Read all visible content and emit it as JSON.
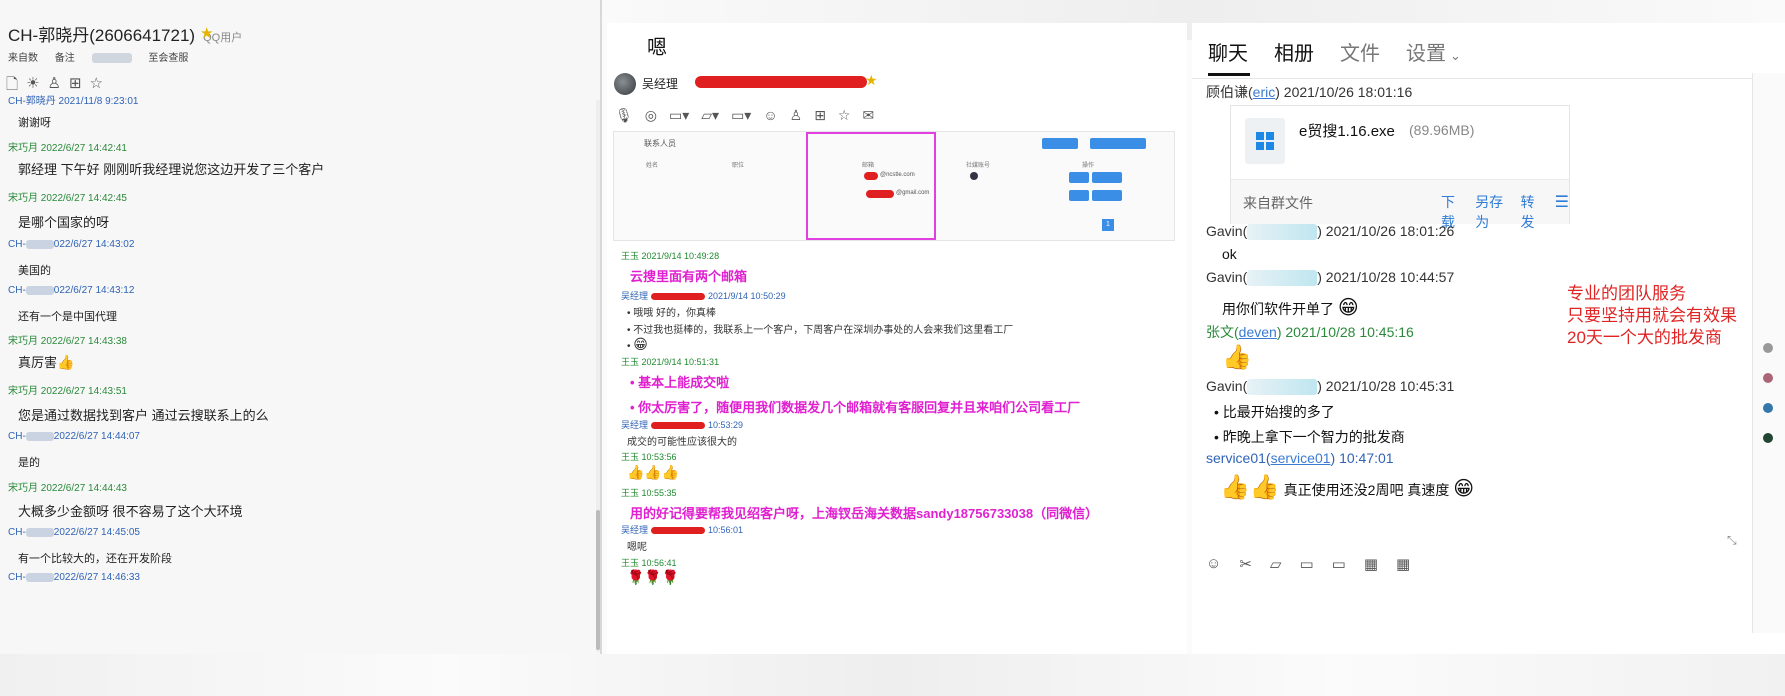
{
  "panel1": {
    "title": "CH-郭晓丹(2606641721)",
    "qq_user": "QQ用户",
    "sub": {
      "a": "来自数",
      "b": "备注",
      "c": "至会查服"
    },
    "log": [
      {
        "meta": "CH-郭晓丹 2021/11/8 9:23:01",
        "text": "谢谢呀"
      },
      {
        "meta": "宋巧月 2022/6/27 14:42:41",
        "text": "郭经理 下午好 刚刚听我经理说您这边开发了三个客户"
      },
      {
        "meta": "宋巧月 2022/6/27 14:42:45",
        "text": "是哪个国家的呀"
      },
      {
        "meta": "022/6/27 14:43:02",
        "text": "美国的"
      },
      {
        "meta": "022/6/27 14:43:12",
        "text": "还有一个是中国代理"
      },
      {
        "meta": "宋巧月 2022/6/27 14:43:38",
        "text": "真厉害"
      },
      {
        "meta": "宋巧月 2022/6/27 14:43:51",
        "text": "您是通过数据找到客户 通过云搜联系上的么"
      },
      {
        "meta": "2022/6/27 14:44:07",
        "text": "是的"
      },
      {
        "meta": "宋巧月 2022/6/27 14:44:43",
        "text": "大概多少金额呀 很不容易了这个大环境"
      },
      {
        "meta": "2022/6/27 14:45:05",
        "text": "有一个比较大的，还在开发阶段"
      },
      {
        "meta": "2022/6/27 14:46:33",
        "text": ""
      }
    ]
  },
  "panel2": {
    "header": "嗯",
    "contact_name": "吴经理",
    "shot": {
      "section": "联系人员",
      "col_name": "姓名",
      "col_pos": "职位",
      "col_mail": "邮箱",
      "col_social": "社媒账号",
      "col_op": "操作",
      "mail1": "@ncstle.com",
      "mail2": "@gmail.com",
      "page": "1"
    },
    "wang1": "王玉 2021/9/14 10:49:28",
    "pink1": "云搜里面有两个邮箱",
    "wu1": "吴经理",
    "wu1_time": "2021/9/14 10:50:29",
    "line1": "哦哦  好的，你真棒",
    "line2": "不过我也挺棒的，我联系上一个客户，下周客户在深圳办事处的人会来我们这里看工厂",
    "wang2": "王玉 2021/9/14 10:51:31",
    "pink2": "基本上能成交啦",
    "pink3": "你太厉害了，随便用我们数据发几个邮箱就有客服回复并且来咱们公司看工厂",
    "wu2": "吴经理",
    "wu2_time": "10:53:29",
    "line3": "成交的可能性应该很大的",
    "wang3": "王玉  10:53:56",
    "thumbs": "👍👍👍",
    "wang4": "王玉  10:55:35",
    "pink4": "用的好记得要帮我见绍客户呀，上海钗岳海关数据sandy18756733038（同微信）",
    "wu3": "吴经理",
    "wu3_time": "10:56:01",
    "line4": "嗯呢",
    "wang5": "王玉  10:56:41",
    "roses": "🌹🌹🌹"
  },
  "panel3": {
    "tabs": [
      "聊天",
      "相册",
      "文件",
      "设置"
    ],
    "msg1_name": "顾伯谦",
    "msg1_link": "eric",
    "msg1_time": "2021/10/26 18:01:16",
    "file": {
      "name": "e贸搜1.16.exe",
      "size": "(89.96MB)",
      "source": "来自群文件",
      "download": "下载",
      "save_as": "另存为",
      "forward": "转发"
    },
    "msg2_name": "Gavin(",
    "msg2_time": "2021/10/26 18:01:26",
    "msg2_text": "ok",
    "msg3_name": "Gavin(",
    "msg3_time": "2021/10/28 10:44:57",
    "msg3_text": "用你们软件开单了",
    "msg4_name": "张文",
    "msg4_link": "deven",
    "msg4_time": "2021/10/28 10:45:16",
    "msg5_name": "Gavin(",
    "msg5_time": "2021/10/28 10:45:31",
    "msg5_text1": "比最开始搜的多了",
    "msg5_text2": "昨晚上拿下一个智力的批发商",
    "msg6_name": "service01",
    "msg6_link": "service01",
    "msg6_time": "10:47:01",
    "msg6_text": "真正使用还没2周吧  真速度",
    "note1": "专业的团队服务",
    "note2": "只要坚持用就会有效果",
    "note3": "20天一个大的批发商"
  }
}
